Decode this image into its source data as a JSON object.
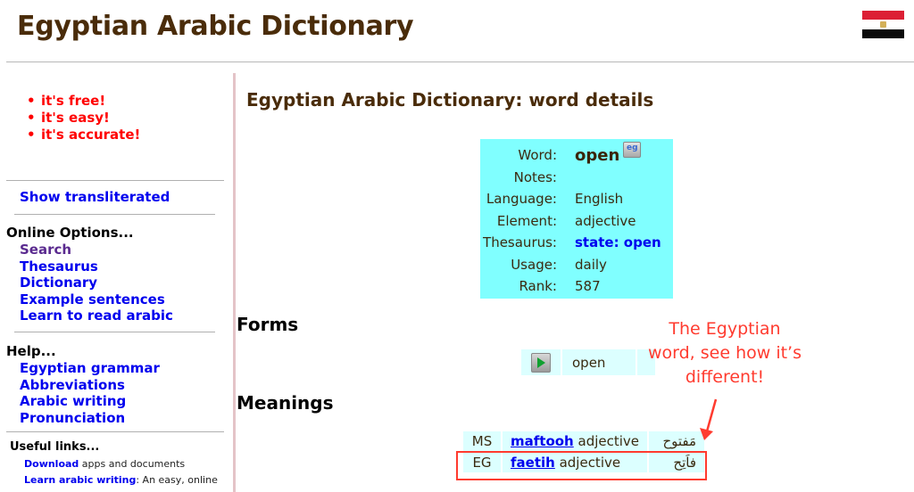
{
  "header": {
    "site_title": "Egyptian Arabic Dictionary",
    "flag_icon": "egypt-flag-icon"
  },
  "sidebar": {
    "promo": [
      "it's free!",
      "it's easy!",
      "it's accurate!"
    ],
    "show_transliterated": "Show transliterated",
    "online_options": {
      "title": "Online Options...",
      "items": [
        "Search",
        "Thesaurus",
        "Dictionary",
        "Example sentences",
        "Learn to read arabic"
      ]
    },
    "help": {
      "title": "Help...",
      "items": [
        "Egyptian grammar",
        "Abbreviations",
        "Arabic writing",
        "Pronunciation"
      ]
    },
    "useful_links": {
      "title": "Useful links...",
      "items": [
        {
          "link": "Download",
          "text": " apps and documents"
        },
        {
          "link": "Learn arabic writing",
          "text": ": An easy, online"
        }
      ]
    }
  },
  "main": {
    "page_title": "Egyptian Arabic Dictionary: word details",
    "word_details": {
      "word_label": "Word:",
      "word_value": "open",
      "eg_button": "eg",
      "notes_label": "Notes:",
      "notes_value": "",
      "language_label": "Language:",
      "language_value": "English",
      "element_label": "Element:",
      "element_value": "adjective",
      "thesaurus_label": "Thesaurus:",
      "thesaurus_value": "state: open",
      "usage_label": "Usage:",
      "usage_value": "daily",
      "rank_label": "Rank:",
      "rank_value": "587"
    },
    "forms_heading": "Forms",
    "forms": [
      {
        "text": "open"
      }
    ],
    "meanings_heading": "Meanings",
    "meanings": [
      {
        "code": "MS",
        "translit": "maftooh",
        "pos": " adjective",
        "arabic": "مَفتوح",
        "highlighted": false
      },
      {
        "code": "EG",
        "translit": "faetih",
        "pos": " adjective",
        "arabic": "فاَتِح",
        "highlighted": true
      }
    ],
    "annotation": "The Egyptian word, see how it’s different!",
    "colors": {
      "title_brown": "#4a2c0a",
      "word_box": "#80ffff",
      "cell_bg": "#dcffff",
      "link_blue": "#0000ee",
      "visited_purple": "#5a2a8f",
      "promo_red": "#ff0000",
      "annotation_red": "#ff3b2f"
    }
  }
}
